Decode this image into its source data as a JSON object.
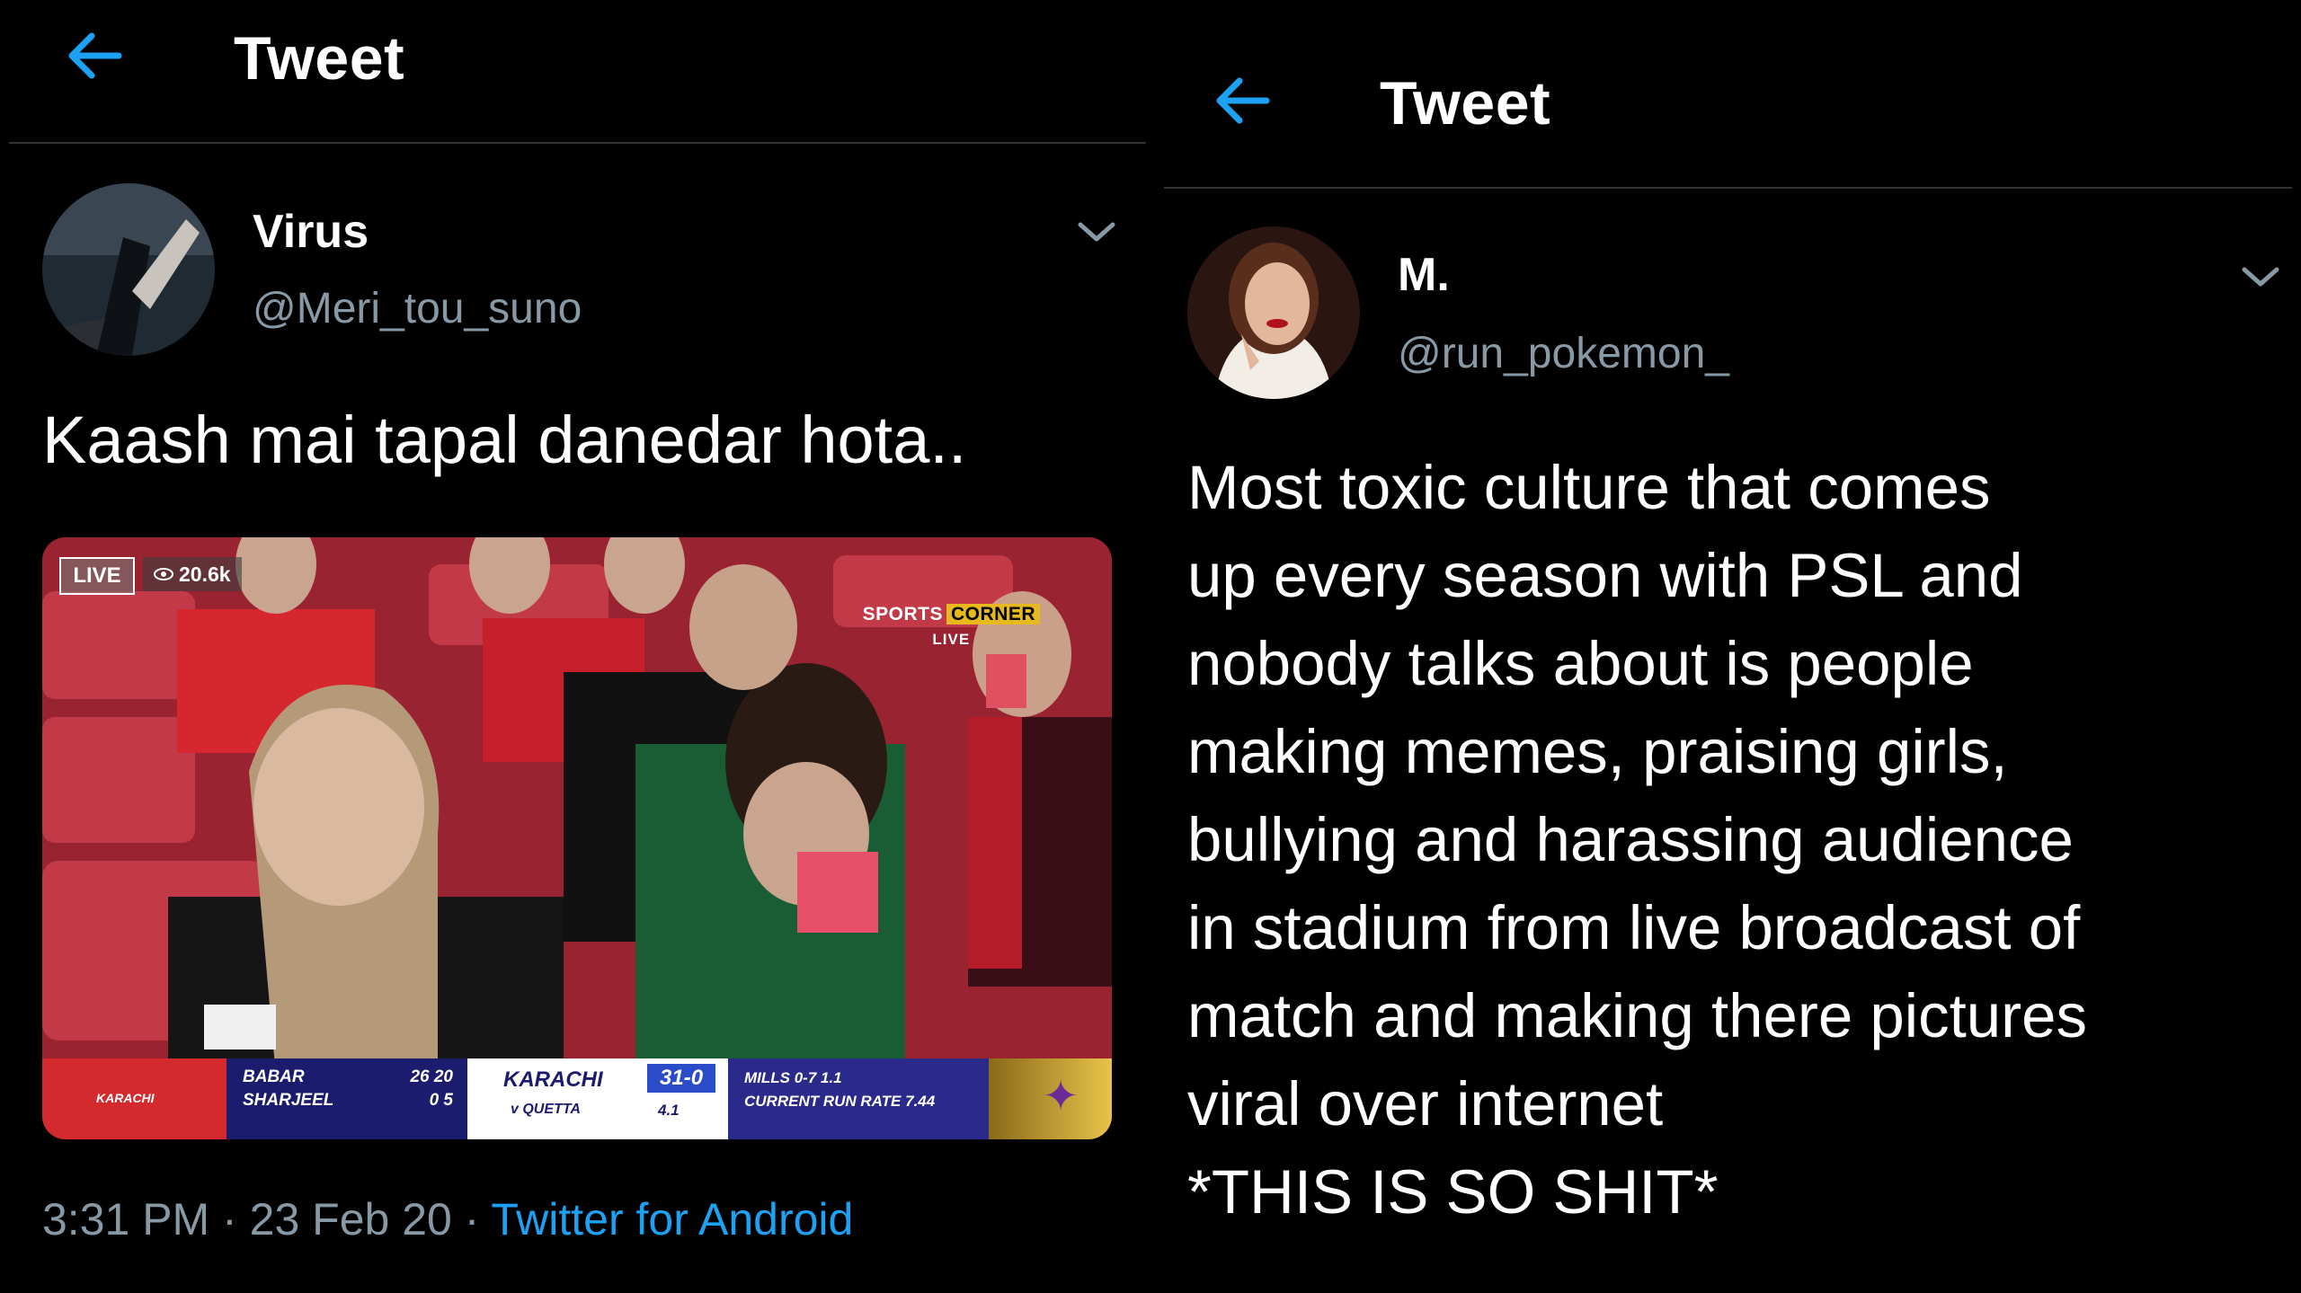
{
  "left_tweet": {
    "header_title": "Tweet",
    "author_name": "Virus",
    "author_handle": "@Meri_tou_suno",
    "text": "Kaash mai tapal danedar hota..",
    "media": {
      "live_label": "LIVE",
      "views": "20.6k",
      "channel_line1": "SPORTS",
      "channel_line1_highlight": "CORNER",
      "channel_line2": "LIVE",
      "scoreboard": {
        "team_badge": "KARACHI",
        "batsman1": "BABAR",
        "batsman1_score": "26 20",
        "batsman2": "SHARJEEL",
        "batsman2_score": "0 5",
        "team": "KARACHI",
        "opponent": "v QUETTA",
        "score": "31-0",
        "overs": "4.1",
        "bowler": "MILLS 0-7 1.1",
        "run_rate": "CURRENT RUN RATE 7.44"
      }
    },
    "time": "3:31 PM",
    "date": "23 Feb 20",
    "source": "Twitter for Android"
  },
  "right_tweet": {
    "header_title": "Tweet",
    "author_name": "M.",
    "author_handle": "@run_pokemon_",
    "text": "Most toxic culture that comes\nup every season with PSL and\nnobody talks about is people\nmaking memes, praising girls,\nbullying and harassing audience\nin stadium from live broadcast of\nmatch and making there pictures\nviral over internet\n*THIS IS SO SHIT*"
  },
  "colors": {
    "background": "#000000",
    "accent": "#1da1f2",
    "muted": "#8899a6",
    "divider": "#2f3336"
  },
  "icons": [
    "back-arrow-icon",
    "chevron-down-icon",
    "eye-icon"
  ]
}
